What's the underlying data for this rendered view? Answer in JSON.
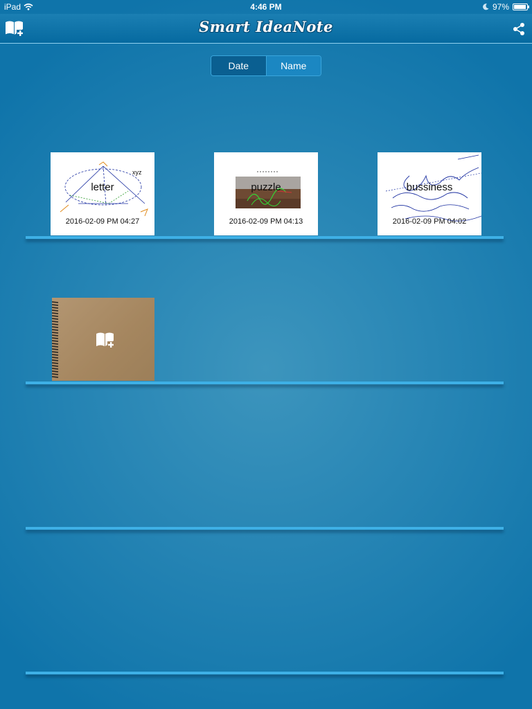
{
  "status_bar": {
    "device": "iPad",
    "time": "4:46 PM",
    "battery_percent": "97%",
    "battery_level": 0.97
  },
  "header": {
    "title": "Smart IdeaNote",
    "left_icon": "add-notebook-icon",
    "right_icon": "share-icon"
  },
  "sort": {
    "options": [
      "Date",
      "Name"
    ],
    "selected": "Date"
  },
  "notes": [
    {
      "name": "letter",
      "date": "2016-02-09 PM 04:27",
      "sketch_text": "xyz"
    },
    {
      "name": "puzzle",
      "date": "2016-02-09 PM 04:13"
    },
    {
      "name": "bussiness",
      "date": "2016-02-09 PM 04:02"
    }
  ],
  "add_notebook": {
    "icon": "add-book-icon"
  },
  "colors": {
    "background": "#2886b5",
    "nav_bar": "#0f74aa",
    "shelf": "#3eb0e6",
    "segment_active": "#0a5f91",
    "notebook_cover": "#a5865f"
  }
}
